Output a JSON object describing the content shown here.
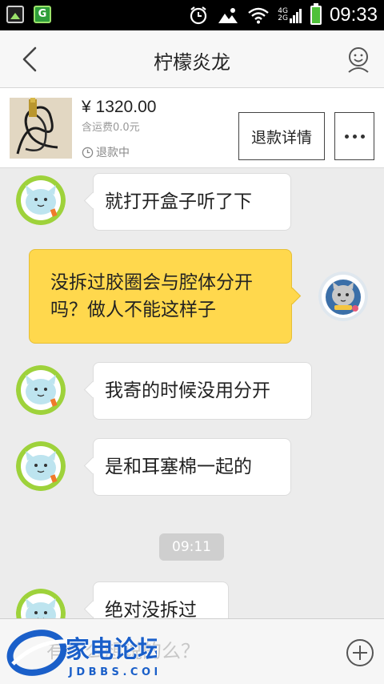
{
  "status_bar": {
    "time": "09:33",
    "network_top": "4G",
    "network_bottom": "2G"
  },
  "header": {
    "title": "柠檬炎龙"
  },
  "order": {
    "price": "¥ 1320.00",
    "shipping": "含运费0.0元",
    "status": "退款中",
    "refund_button": "退款详情"
  },
  "messages": [
    {
      "side": "left",
      "text": "就打开盒子听了下"
    },
    {
      "side": "right",
      "text": "没拆过胶圈会与腔体分开吗？做人不能这样子"
    },
    {
      "side": "left",
      "text": "我寄的时候没用分开"
    },
    {
      "side": "left",
      "text": "是和耳塞棉一起的"
    },
    {
      "side": "left",
      "text": "绝对没拆过"
    }
  ],
  "timestamp": "09:11",
  "input": {
    "placeholder": "有什么想说的么？"
  },
  "watermark": {
    "brand": "家电论坛",
    "url": "JDBBS.COM"
  },
  "colors": {
    "own_bubble": "#ffd84d",
    "avatar_ring": "#9ed23b",
    "status_bar": "#000000"
  }
}
